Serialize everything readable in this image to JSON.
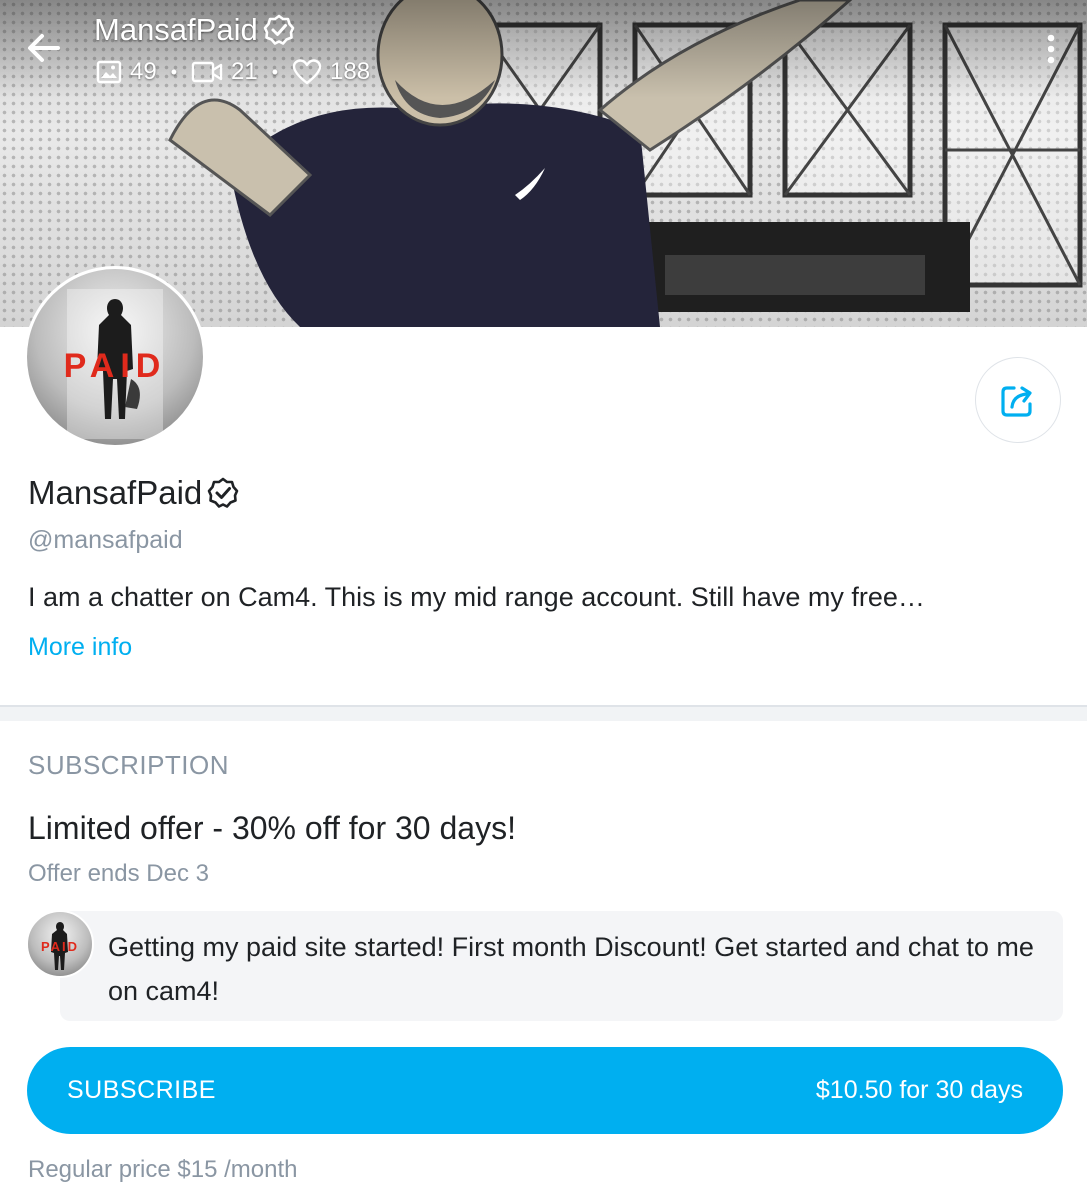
{
  "header": {
    "title": "MansafPaid",
    "verified_icon": "verified-badge-icon",
    "back_icon": "arrow-left-icon",
    "more_icon": "vertical-dots-icon",
    "stats": [
      {
        "icon": "image-icon",
        "value": "49"
      },
      {
        "icon": "video-icon",
        "value": "21"
      },
      {
        "icon": "heart-icon",
        "value": "188"
      }
    ],
    "separator": "•"
  },
  "profile": {
    "avatar_text": "PAID",
    "name": "MansafPaid",
    "handle": "@mansafpaid",
    "bio": "I am a chatter on Cam4. This is my mid range account. Still have my free…",
    "more_info": "More info",
    "share_icon": "share-icon"
  },
  "subscription": {
    "section_label": "SUBSCRIPTION",
    "offer_title": "Limited offer - 30% off for 30 days!",
    "offer_ends": "Offer ends Dec 3",
    "message_avatar_text": "PAID",
    "message": "Getting my paid site started! First month Discount! Get started and chat to me on cam4!",
    "button_label": "SUBSCRIBE",
    "button_price": "$10.50 for 30 days",
    "regular_price": "Regular price $15 /month"
  },
  "colors": {
    "accent": "#00aff0",
    "muted_text": "#8a96a3",
    "primary_text": "#1f2225",
    "avatar_text": "#e02a1c"
  }
}
